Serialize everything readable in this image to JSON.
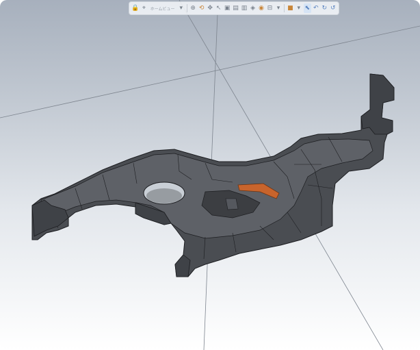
{
  "viewer": {
    "toolbar": {
      "items": [
        {
          "icon": "lock-icon",
          "glyph": "🔒"
        },
        {
          "icon": "coordinate-system-icon",
          "glyph": "⌖"
        },
        {
          "icon": "view-orientation-label",
          "label": "ホームビュー"
        },
        {
          "icon": "dropdown-icon",
          "glyph": "▾"
        },
        {
          "icon": "zoom-icon",
          "glyph": "⊕"
        },
        {
          "icon": "rotate-icon",
          "glyph": "⟲"
        },
        {
          "icon": "pan-icon",
          "glyph": "✥"
        },
        {
          "icon": "select-icon",
          "glyph": "↖"
        },
        {
          "icon": "view-front-icon",
          "glyph": "▣"
        },
        {
          "icon": "view-top-icon",
          "glyph": "▤"
        },
        {
          "icon": "view-right-icon",
          "glyph": "▥"
        },
        {
          "icon": "view-iso-icon",
          "glyph": "◈"
        },
        {
          "icon": "render-mode-icon",
          "glyph": "◉"
        },
        {
          "icon": "section-icon",
          "glyph": "⊟"
        },
        {
          "icon": "dropdown-icon",
          "glyph": "▾"
        },
        {
          "icon": "color-icon",
          "glyph": "■"
        },
        {
          "icon": "dropdown-icon",
          "glyph": "▾"
        },
        {
          "icon": "pointer-icon",
          "glyph": "⬉"
        },
        {
          "icon": "undo-icon",
          "glyph": "↶"
        },
        {
          "icon": "redo-icon",
          "glyph": "↻"
        },
        {
          "icon": "refresh-icon",
          "glyph": "↺"
        }
      ]
    },
    "model": {
      "part_color": "#4a4d52",
      "edge_color": "#1c1d20",
      "highlight_color": "#c8642c"
    },
    "background": {
      "top": "#a7b0bd",
      "bottom": "#ffffff"
    }
  }
}
